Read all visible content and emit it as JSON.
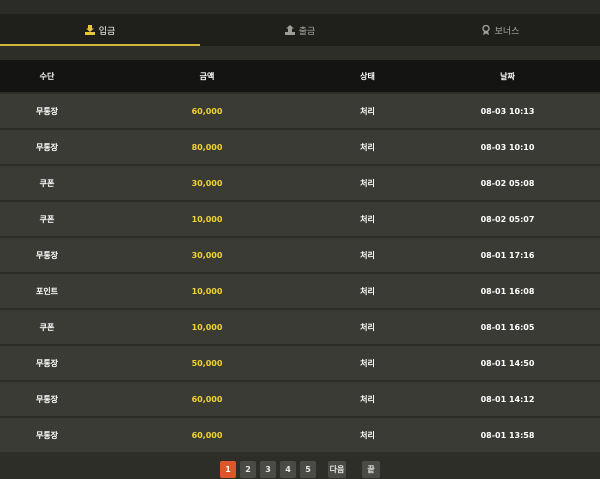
{
  "tabs": [
    {
      "label": "입금",
      "icon": "deposit-icon",
      "active": true
    },
    {
      "label": "출금",
      "icon": "withdraw-icon",
      "active": false
    },
    {
      "label": "보너스",
      "icon": "bonus-icon",
      "active": false
    }
  ],
  "table": {
    "headers": [
      "수단",
      "금액",
      "상태",
      "날짜"
    ],
    "rows": [
      {
        "method": "무통장",
        "amount": "60,000",
        "status": "처리",
        "date": "08-03 10:13"
      },
      {
        "method": "무통장",
        "amount": "80,000",
        "status": "처리",
        "date": "08-03 10:10"
      },
      {
        "method": "쿠폰",
        "amount": "30,000",
        "status": "처리",
        "date": "08-02 05:08"
      },
      {
        "method": "쿠폰",
        "amount": "10,000",
        "status": "처리",
        "date": "08-02 05:07"
      },
      {
        "method": "무통장",
        "amount": "30,000",
        "status": "처리",
        "date": "08-01 17:16"
      },
      {
        "method": "포인트",
        "amount": "10,000",
        "status": "처리",
        "date": "08-01 16:08"
      },
      {
        "method": "쿠폰",
        "amount": "10,000",
        "status": "처리",
        "date": "08-01 16:05"
      },
      {
        "method": "무통장",
        "amount": "50,000",
        "status": "처리",
        "date": "08-01 14:50"
      },
      {
        "method": "무통장",
        "amount": "60,000",
        "status": "처리",
        "date": "08-01 14:12"
      },
      {
        "method": "무통장",
        "amount": "60,000",
        "status": "처리",
        "date": "08-01 13:58"
      }
    ]
  },
  "pagination": {
    "pages": [
      "1",
      "2",
      "3",
      "4",
      "5"
    ],
    "current": "1",
    "next_label": "다음",
    "last_label": "끝"
  },
  "colors": {
    "accent": "#d2b63a",
    "amount": "#f2d32b",
    "active_page": "#e0562b"
  }
}
